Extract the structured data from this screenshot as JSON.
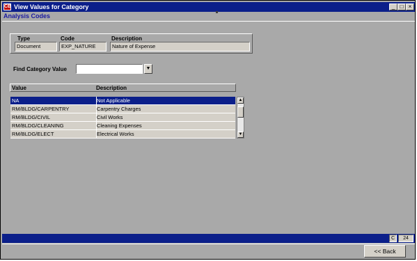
{
  "window": {
    "title": "View Values for Category",
    "app_icon_text": "CB",
    "minimize_glyph": "_",
    "maximize_glyph": "□",
    "close_glyph": "×"
  },
  "subtitle": "Analysis Codes",
  "category": {
    "type_label": "Type",
    "code_label": "Code",
    "description_label": "Description",
    "type_value": "Document",
    "code_value": "EXP_NATURE",
    "description_value": "Nature of Expense"
  },
  "find": {
    "label": "Find Category Value",
    "value": "",
    "button_glyph": "▼"
  },
  "grid": {
    "columns": [
      "Value",
      "Description"
    ],
    "rows": [
      {
        "value": "NA",
        "description": "Not Applicable",
        "selected": true
      },
      {
        "value": "RM/BLDG/CARPENTRY",
        "description": "Carpentry Charges",
        "selected": false
      },
      {
        "value": "RM/BLDG/CIVIL",
        "description": "Civil Works",
        "selected": false
      },
      {
        "value": "RM/BLDG/CLEANING",
        "description": "Cleaning Expenses",
        "selected": false
      },
      {
        "value": "RM/BLDG/ELECT",
        "description": "Electrical Works",
        "selected": false
      }
    ],
    "scroll_up_glyph": "▲",
    "scroll_down_glyph": "▼"
  },
  "status": {
    "mode": "C",
    "count": "24"
  },
  "back_button": "<< Back",
  "colors": {
    "title_bar": "#0b1f8a",
    "background": "#a9a9a9",
    "field": "#d4d0c8",
    "selection": "#0b1f8a",
    "subtitle": "#1a1aa0"
  }
}
